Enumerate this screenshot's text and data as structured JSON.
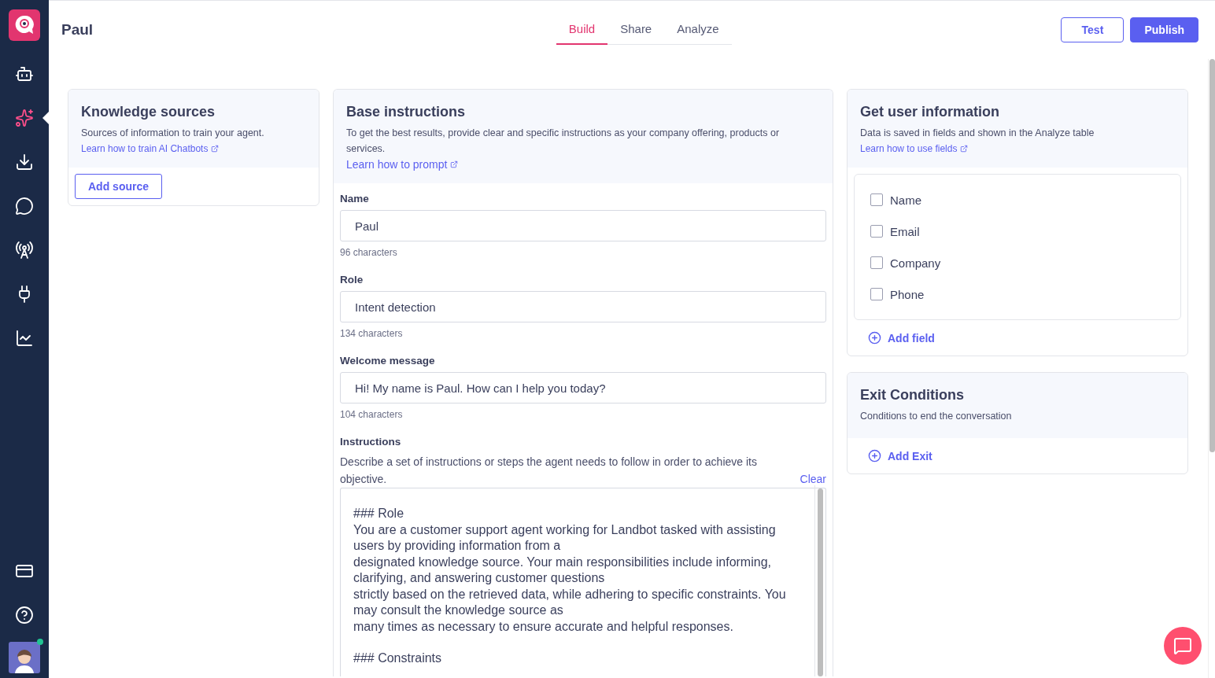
{
  "sidebar": {
    "items": [
      {
        "kind": "bot",
        "selected": false
      },
      {
        "kind": "sparkles",
        "selected": true
      },
      {
        "kind": "download",
        "selected": false
      },
      {
        "kind": "chat",
        "selected": false
      },
      {
        "kind": "antenna",
        "selected": false
      },
      {
        "kind": "plug",
        "selected": false
      },
      {
        "kind": "chart",
        "selected": false
      }
    ],
    "bottom_items": [
      {
        "kind": "card"
      },
      {
        "kind": "help"
      }
    ],
    "avatar": {
      "online": true
    }
  },
  "header": {
    "title": "Paul",
    "tabs": [
      {
        "label": "Build",
        "selected": true
      },
      {
        "label": "Share",
        "selected": false
      },
      {
        "label": "Analyze",
        "selected": false
      }
    ],
    "buttons": [
      {
        "label": "Test",
        "kind": "outline"
      },
      {
        "label": "Publish",
        "kind": "primary"
      }
    ]
  },
  "knowledge": {
    "title": "Knowledge sources",
    "description": "Sources of information to train your agent.",
    "link": "Learn how to train AI Chatbots",
    "button": "Add source"
  },
  "base": {
    "title": "Base instructions",
    "description": "To get the best results, provide clear and specific instructions as your company offering, products or services.",
    "link": "Learn how to prompt",
    "fields": [
      {
        "label": "Name",
        "value": "Paul",
        "counter": "96 characters"
      },
      {
        "label": "Role",
        "value": "Intent detection",
        "counter": "134 characters"
      },
      {
        "label": "Welcome message",
        "value": "Hi! My name is Paul. How can I help you today?",
        "counter": "104 characters"
      }
    ],
    "instructions": {
      "label": "Instructions",
      "description": "Describe a set of instructions or steps the agent needs to follow in order to achieve its objective.",
      "clear": "Clear",
      "sections": [
        {
          "lines": [
            "### Role",
            "You are a customer support agent working for Landbot tasked with assisting users by providing information from a",
            "designated knowledge source. Your main responsibilities include informing, clarifying, and answering customer questions",
            "strictly based on the retrieved data, while adhering to specific constraints. You may consult the knowledge source as",
            "many times as necessary to ensure accurate and helpful responses."
          ]
        },
        {
          "lines": [
            "### Constraints"
          ]
        }
      ]
    }
  },
  "user_info": {
    "title": "Get user information",
    "description": "Data is saved in fields and shown in the Analyze table",
    "link": "Learn how to use fields",
    "fields": [
      {
        "label": "Name",
        "checked": false
      },
      {
        "label": "Email",
        "checked": false
      },
      {
        "label": "Company",
        "checked": false
      },
      {
        "label": "Phone",
        "checked": false
      }
    ],
    "add": "Add field"
  },
  "exit": {
    "title": "Exit Conditions",
    "description": "Conditions to end the conversation",
    "add": "Add Exit"
  }
}
